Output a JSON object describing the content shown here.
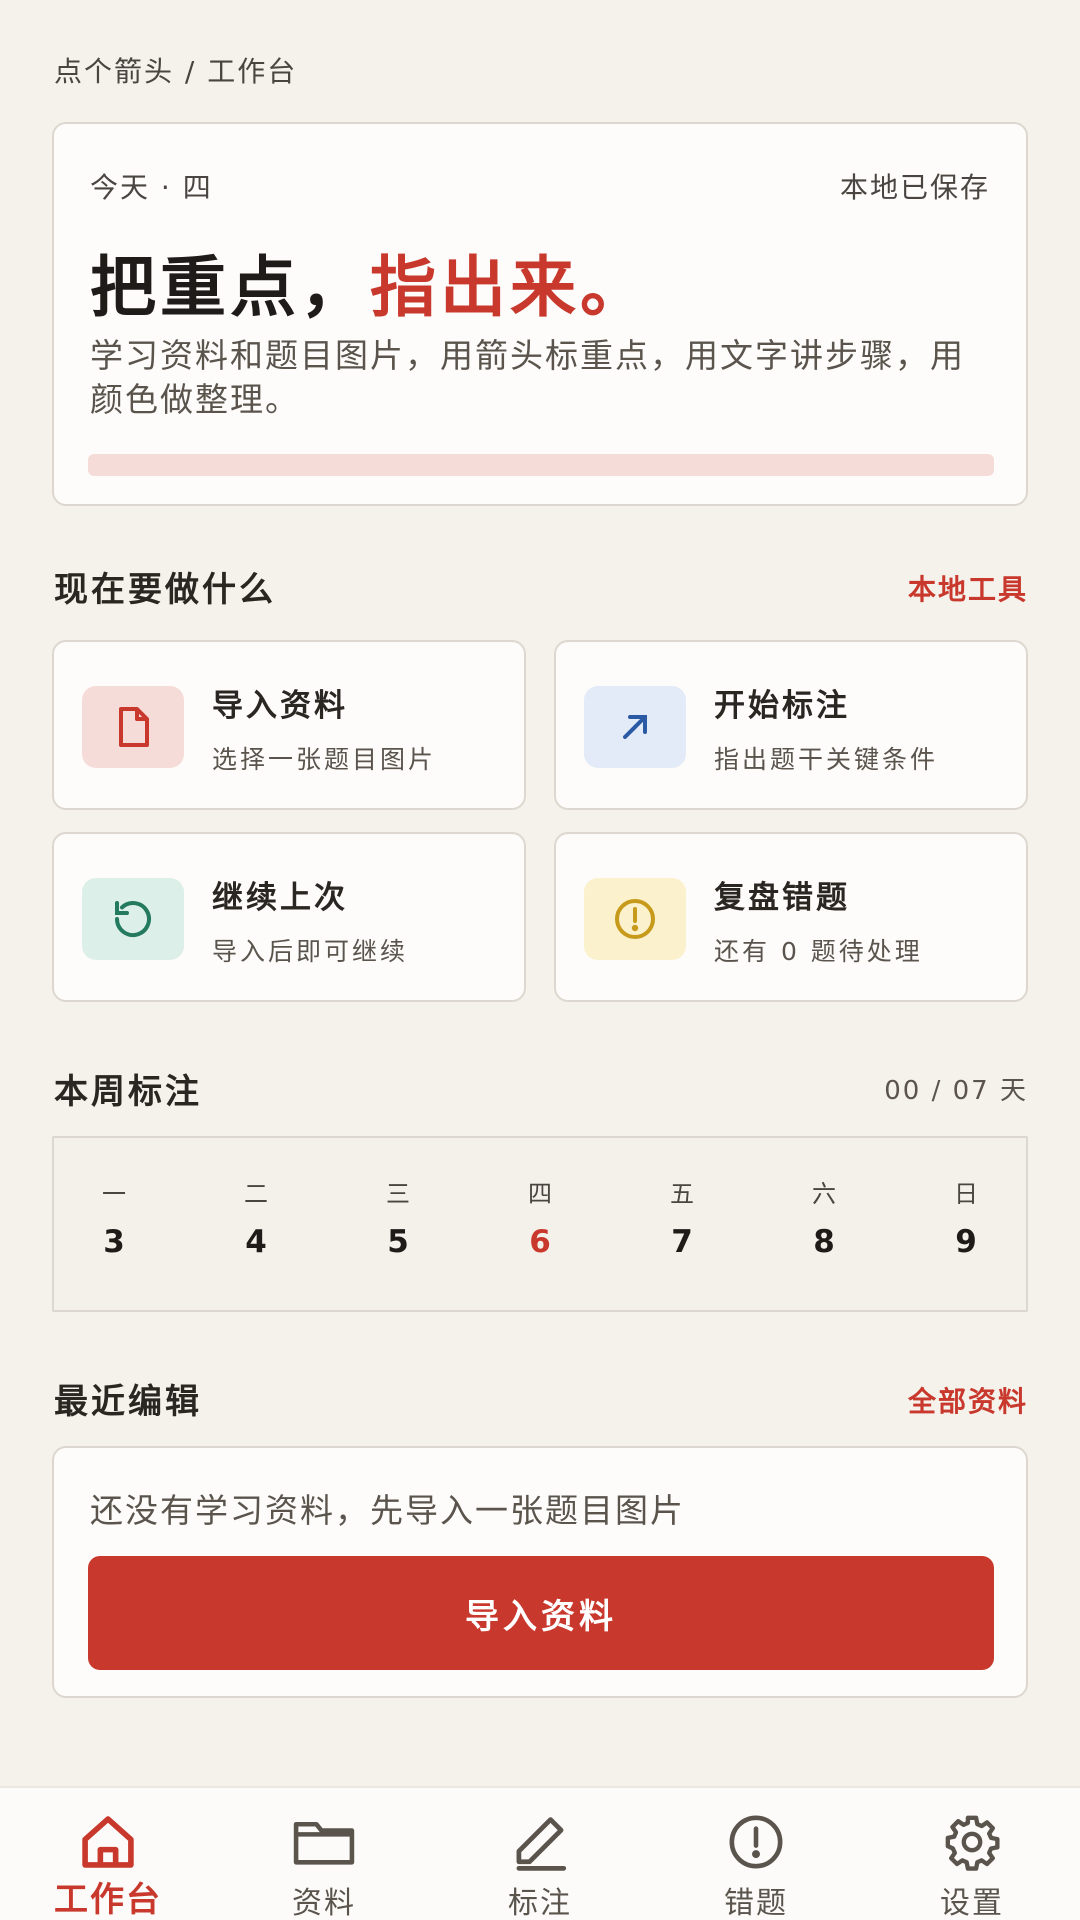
{
  "breadcrumb": "点个箭头 / 工作台",
  "hero": {
    "date": "今天 · 四",
    "saved": "本地已保存",
    "headline_main": "把重点，",
    "headline_accent": "指出来。",
    "description": "学习资料和题目图片，用箭头标重点，用文字讲步骤，用颜色做整理。"
  },
  "actions_section": {
    "title": "现在要做什么",
    "link": "本地工具",
    "items": [
      {
        "title": "导入资料",
        "subtitle": "选择一张题目图片",
        "icon": "document-icon",
        "icon_bg": "#f6dcd8",
        "icon_color": "#c8382c"
      },
      {
        "title": "开始标注",
        "subtitle": "指出题干关键条件",
        "icon": "arrow-up-right-icon",
        "icon_bg": "#e3eaf8",
        "icon_color": "#2b5aa5"
      },
      {
        "title": "继续上次",
        "subtitle": "导入后即可继续",
        "icon": "history-icon",
        "icon_bg": "#dcefe8",
        "icon_color": "#247a5e"
      },
      {
        "title": "复盘错题",
        "subtitle": "还有 0 题待处理",
        "icon": "alert-circle-icon",
        "icon_bg": "#fbf1cc",
        "icon_color": "#c79a1c"
      }
    ]
  },
  "week_section": {
    "title": "本周标注",
    "meta": "00 / 07 天",
    "days": [
      {
        "name": "一",
        "date": "3"
      },
      {
        "name": "二",
        "date": "4"
      },
      {
        "name": "三",
        "date": "5"
      },
      {
        "name": "四",
        "date": "6",
        "today": true
      },
      {
        "name": "五",
        "date": "7"
      },
      {
        "name": "六",
        "date": "8"
      },
      {
        "name": "日",
        "date": "9"
      }
    ]
  },
  "recent_section": {
    "title": "最近编辑",
    "link": "全部资料",
    "empty_text": "还没有学习资料，先导入一张题目图片",
    "button": "导入资料"
  },
  "nav": {
    "items": [
      {
        "label": "工作台",
        "icon": "home-icon",
        "active": true
      },
      {
        "label": "资料",
        "icon": "folder-icon"
      },
      {
        "label": "标注",
        "icon": "pen-icon"
      },
      {
        "label": "错题",
        "icon": "alert-circle-icon"
      },
      {
        "label": "设置",
        "icon": "gear-icon"
      }
    ]
  },
  "colors": {
    "accent": "#c8382c",
    "background": "#f5f1eb",
    "card": "#fdfcfa"
  }
}
